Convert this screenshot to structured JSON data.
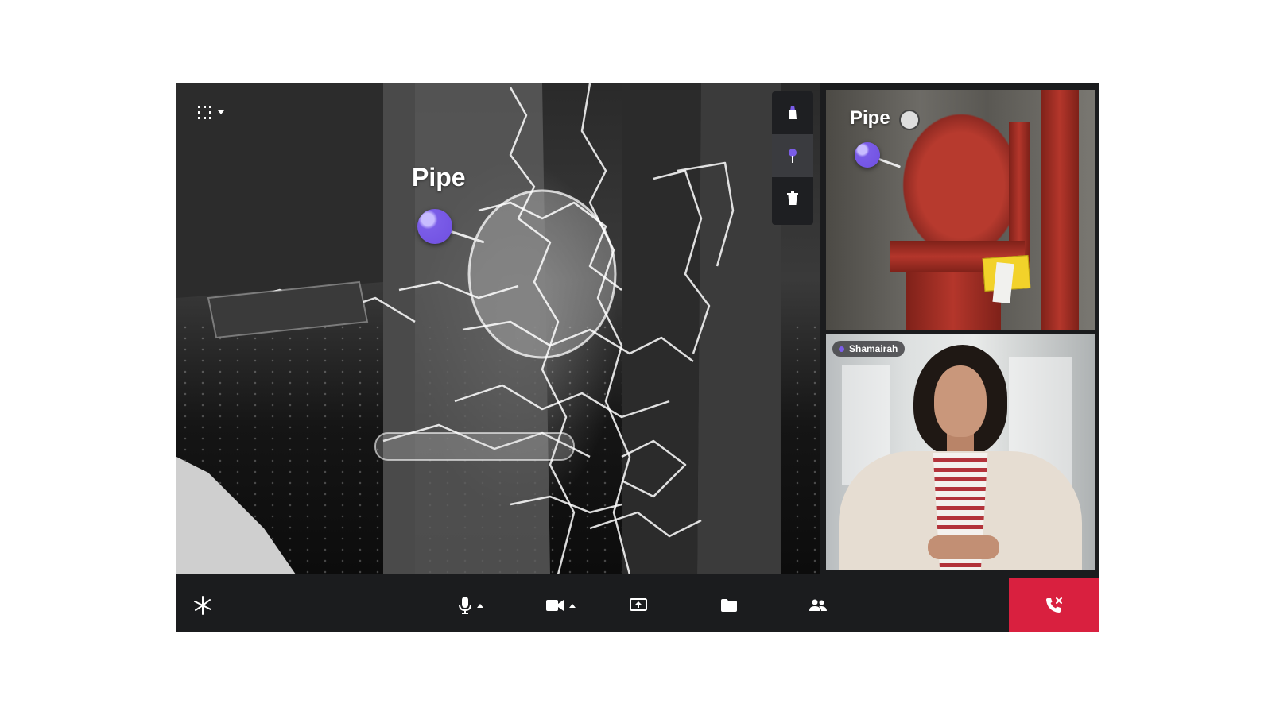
{
  "main_view": {
    "annotation": {
      "label": "Pipe"
    }
  },
  "remote_view": {
    "annotation": {
      "label": "Pipe"
    }
  },
  "participant": {
    "name": "Shamairah"
  },
  "toolbar_icons": {
    "grid": "grid-dots-icon",
    "tools": [
      "eraser-icon",
      "pin-icon",
      "trash-icon"
    ],
    "controls": [
      "microphone-icon",
      "camera-icon",
      "share-screen-icon",
      "folder-icon",
      "participants-icon"
    ],
    "hang_up": "end-call-icon",
    "logo": "sparkle-logo-icon"
  },
  "colors": {
    "accent": "#6f4fe0",
    "hang_up": "#d9203f",
    "bar": "#1b1c1e"
  }
}
